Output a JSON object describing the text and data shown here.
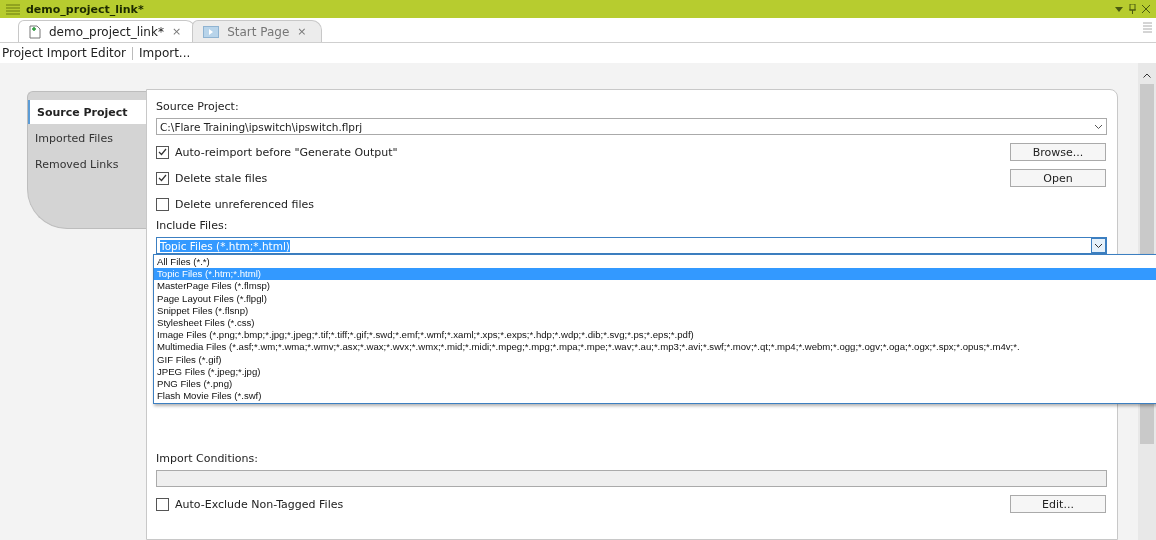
{
  "window": {
    "title": "demo_project_link*"
  },
  "tabs": [
    {
      "label": "demo_project_link*",
      "close": "×",
      "selected": true,
      "kind": "project"
    },
    {
      "label": "Start Page",
      "close": "×",
      "selected": false,
      "kind": "start"
    }
  ],
  "toolbar": [
    "Project Import Editor",
    "Import..."
  ],
  "side_tabs": [
    {
      "label": "Source Project",
      "selected": true
    },
    {
      "label": "Imported Files",
      "selected": false
    },
    {
      "label": "Removed Links",
      "selected": false
    }
  ],
  "source_project": {
    "label": "Source Project:",
    "value": "C:\\Flare Training\\ipswitch\\ipswitch.flprj"
  },
  "options": [
    {
      "label": "Auto-reimport before \"Generate Output\"",
      "checked": true,
      "button": "Browse..."
    },
    {
      "label": "Delete stale files",
      "checked": true,
      "button": "Open"
    },
    {
      "label": "Delete unreferenced files",
      "checked": false
    }
  ],
  "include_files": {
    "label": "Include Files:",
    "value": "Topic Files (*.htm;*.html)",
    "expanded": true,
    "options": [
      {
        "label": "All Files (*.*)",
        "selected": false
      },
      {
        "label": "Topic Files (*.htm;*.html)",
        "selected": true
      },
      {
        "label": "MasterPage Files (*.flmsp)",
        "selected": false
      },
      {
        "label": "Page Layout Files (*.flpgl)",
        "selected": false
      },
      {
        "label": "Snippet Files (*.flsnp)",
        "selected": false
      },
      {
        "label": "Stylesheet Files (*.css)",
        "selected": false
      },
      {
        "label": "Image Files (*.png;*.bmp;*.jpg;*.jpeg;*.tif;*.tiff;*.gif;*.swd;*.emf;*.wmf;*.xaml;*.xps;*.exps;*.hdp;*.wdp;*.dib;*.svg;*.ps;*.eps;*.pdf)",
        "selected": false
      },
      {
        "label": "Multimedia Files (*.asf;*.wm;*.wma;*.wmv;*.asx;*.wax;*.wvx;*.wmx;*.mid;*.midi;*.mpeg;*.mpg;*.mpa;*.mpe;*.wav;*.au;*.mp3;*.avi;*.swf;*.mov;*.qt;*.mp4;*.webm;*.ogg;*.ogv;*.oga;*.ogx;*.spx;*.opus;*.m4v;*.",
        "selected": false
      },
      {
        "label": "GIF Files (*.gif)",
        "selected": false
      },
      {
        "label": "JPEG Files (*.jpeg;*.jpg)",
        "selected": false
      },
      {
        "label": "PNG Files (*.png)",
        "selected": false
      },
      {
        "label": "Flash Movie Files (*.swf)",
        "selected": false
      }
    ]
  },
  "import_conditions": {
    "label": "Import Conditions:"
  },
  "auto_exclude": {
    "label": "Auto-Exclude Non-Tagged Files",
    "checked": false,
    "button": "Edit..."
  }
}
